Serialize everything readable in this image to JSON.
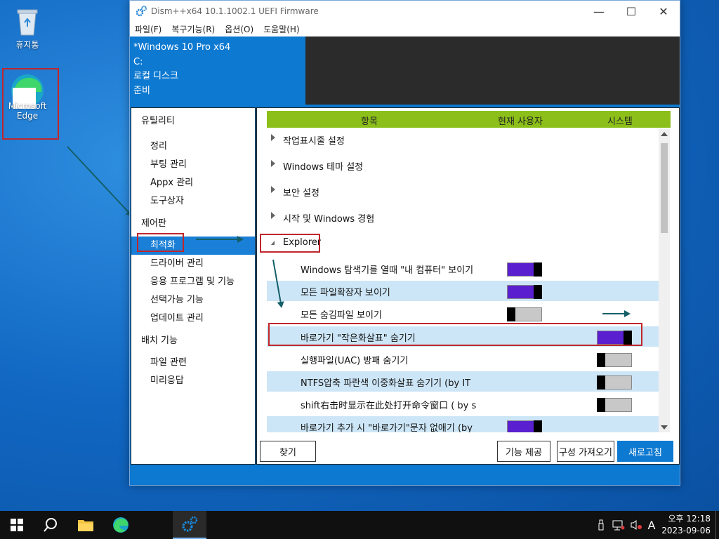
{
  "desktop": {
    "recycle_bin_label": "휴지통",
    "edge_label": "Microsoft Edge"
  },
  "window": {
    "title": "Dism++x64 10.1.1002.1 UEFI Firmware",
    "menu": [
      "파일(F)",
      "복구기능(R)",
      "옵션(O)",
      "도움말(H)"
    ],
    "info": {
      "os": "*Windows 10 Pro x64",
      "drive": "C:",
      "disk": "로컬 디스크",
      "status": "준비"
    }
  },
  "nav": {
    "group_utility": "유틸리티",
    "utility_items": [
      "정리",
      "부팅 관리",
      "Appx 관리",
      "도구상자"
    ],
    "group_control": "제어판",
    "control_items": [
      "최적화",
      "드라이버 관리",
      "응용 프로그램 및 기능",
      "선택가능 기능",
      "업데이트 관리"
    ],
    "selected": "최적화",
    "group_deploy": "배치 기능",
    "deploy_items": [
      "파일 관련",
      "미리응답"
    ]
  },
  "grid": {
    "col_item": "항목",
    "col_user": "현재 사용자",
    "col_system": "시스템",
    "categories": [
      "작업표시줄 설정",
      "Windows 테마 설정",
      "보안 설정",
      "시작 및 Windows 경험"
    ],
    "expanded": "Explorer",
    "rows": [
      {
        "label": "Windows 탐색기를 열때 \"내 컴퓨터\" 보이기",
        "user": "on",
        "system": ""
      },
      {
        "label": "모든 파일확장자 보이기",
        "user": "on",
        "system": ""
      },
      {
        "label": "모든 숨김파일 보이기",
        "user": "off",
        "system": ""
      },
      {
        "label": "바로가기 \"작은화살표\" 숨기기",
        "user": "",
        "system": "on"
      },
      {
        "label": "실행파일(UAC) 방패 숨기기",
        "user": "",
        "system": "off"
      },
      {
        "label": "NTFS압축 파란색 이중화살표 숨기기 (by IT",
        "user": "",
        "system": "off"
      },
      {
        "label": "shift右击时显示在此处打开命令窗口 ( by s",
        "user": "",
        "system": "off"
      },
      {
        "label": "바로가기 추가 시 \"바로가기\"문자 없애기 (by",
        "user": "on",
        "system": ""
      }
    ]
  },
  "buttons": {
    "find": "찾기",
    "provide": "기능 제공",
    "import": "구성 가져오기",
    "refresh": "새로고침"
  },
  "taskbar": {
    "ime": "A",
    "time": "오후 12:18",
    "date": "2023-09-06"
  },
  "colors": {
    "accent": "#0d79d1",
    "header": "#8cbf1a",
    "toggle_on": "#5a1fcf",
    "annotation_red": "#c0262d"
  }
}
